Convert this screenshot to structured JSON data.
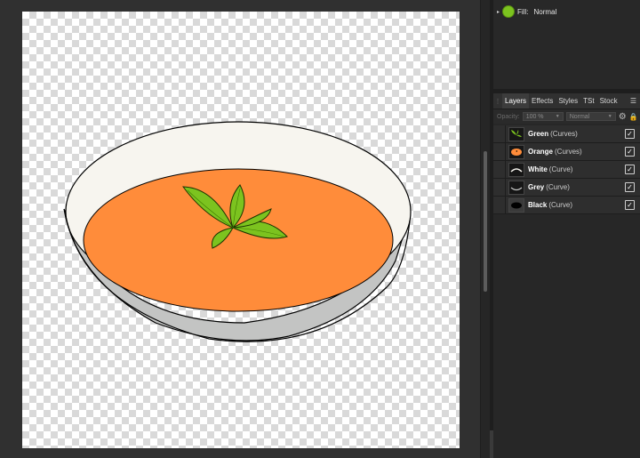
{
  "fill": {
    "label": "Fill:",
    "mode": "Normal",
    "color": "#7cc31f"
  },
  "tabs": [
    {
      "label": "Layers",
      "active": true
    },
    {
      "label": "Effects",
      "active": false
    },
    {
      "label": "Styles",
      "active": false
    },
    {
      "label": "TSt",
      "active": false
    },
    {
      "label": "Stock",
      "active": false
    }
  ],
  "controls": {
    "opacity_label": "Opacity:",
    "opacity_value": "100 %",
    "blend_mode": "Normal"
  },
  "layers": [
    {
      "name": "Green",
      "type": "(Curves)",
      "visible": true
    },
    {
      "name": "Orange",
      "type": "(Curves)",
      "visible": true
    },
    {
      "name": "White",
      "type": "(Curve)",
      "visible": true
    },
    {
      "name": "Grey",
      "type": "(Curve)",
      "visible": true
    },
    {
      "name": "Black",
      "type": "(Curve)",
      "visible": true
    }
  ],
  "colors": {
    "soup": "#ff8c3a",
    "bowl_inner": "#f7f5ef",
    "bowl_outer": "#c3c4c3",
    "leaf": "#7cc31f"
  }
}
